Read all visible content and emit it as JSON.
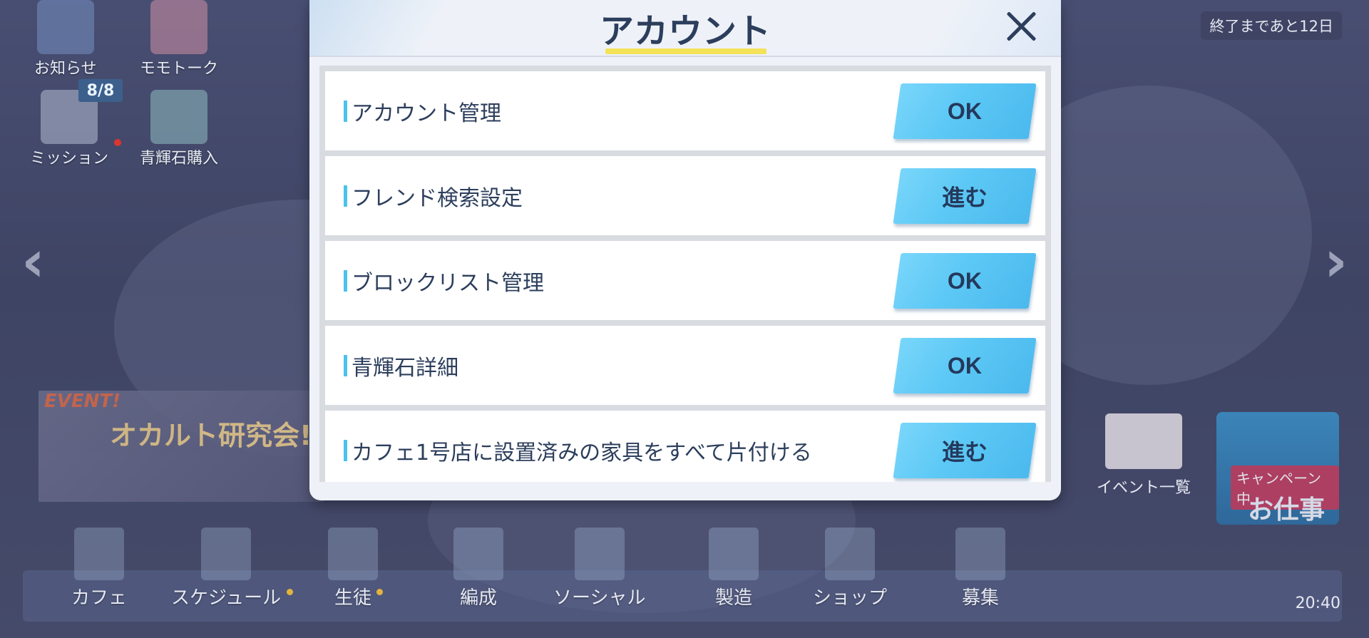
{
  "hud": {
    "notice_label": "お知らせ",
    "momotalk_label": "モモトーク",
    "mission_label": "ミッション",
    "mission_badge": "8/8",
    "pyroxene_label": "青輝石購入",
    "days_left": "終了まであと12日"
  },
  "event": {
    "tag": "EVENT!",
    "logo": "オカルト研究会!",
    "event_list_label": "イベント一覧",
    "campaign_badge": "キャンペーン中",
    "work_label": "お仕事"
  },
  "nav": {
    "items": [
      {
        "label": "カフェ"
      },
      {
        "label": "スケジュール"
      },
      {
        "label": "生徒"
      },
      {
        "label": "編成"
      },
      {
        "label": "ソーシャル"
      },
      {
        "label": "製造"
      },
      {
        "label": "ショップ"
      },
      {
        "label": "募集"
      }
    ],
    "clock": "20:40"
  },
  "modal": {
    "title": "アカウント",
    "rows": [
      {
        "label": "アカウント管理",
        "button": "OK"
      },
      {
        "label": "フレンド検索設定",
        "button": "進む"
      },
      {
        "label": "ブロックリスト管理",
        "button": "OK"
      },
      {
        "label": "青輝石詳細",
        "button": "OK"
      },
      {
        "label": "カフェ1号店に設置済みの家具をすべて片付ける",
        "button": "進む"
      }
    ]
  },
  "colors": {
    "accent_button": "#5cc8f5",
    "title_underline": "#f3e25a",
    "text_dark": "#2c3e5c"
  }
}
